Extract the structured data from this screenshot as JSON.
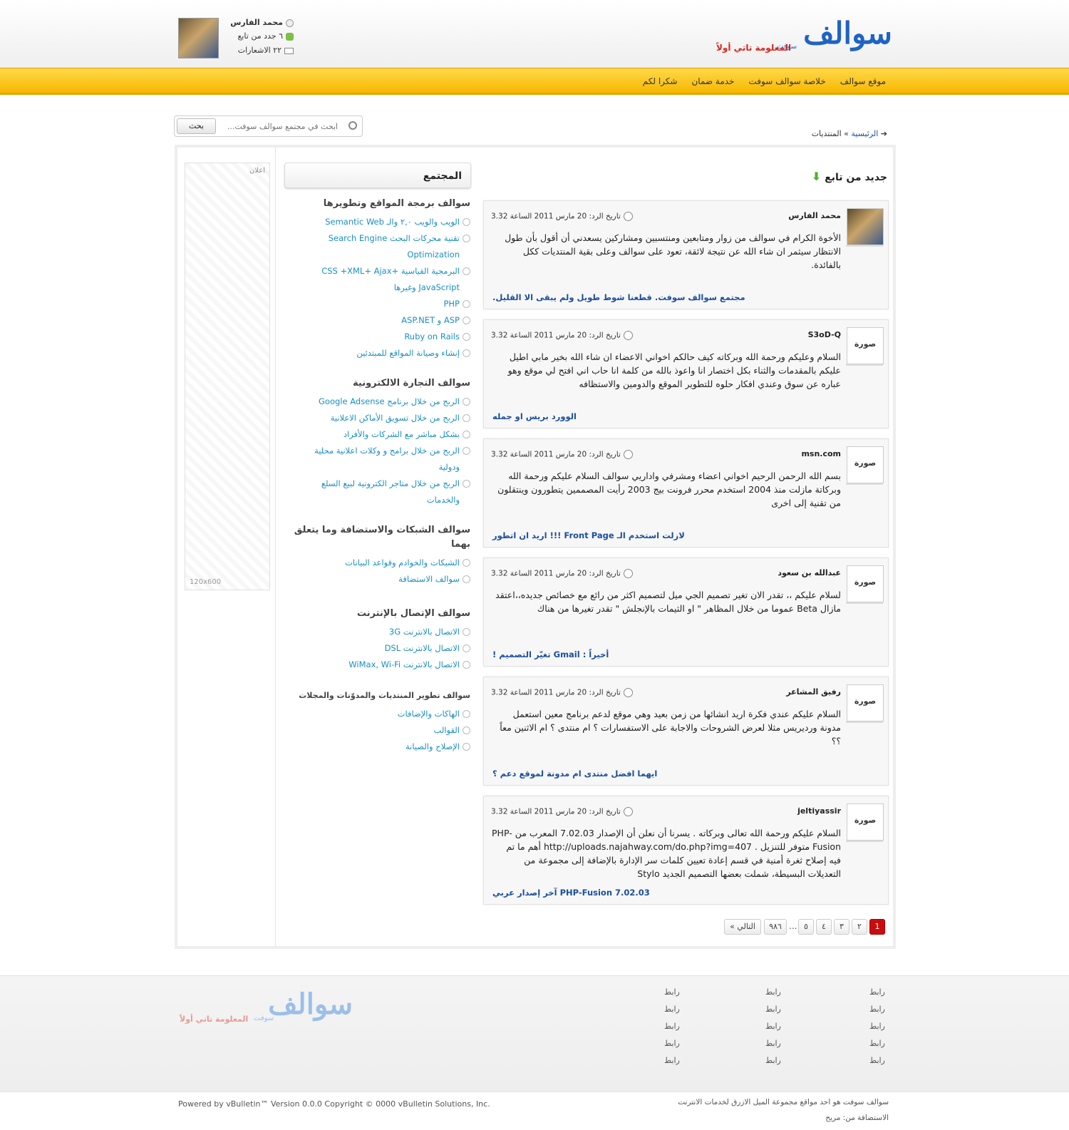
{
  "header": {
    "logo_word": "سوالف",
    "logo_sub": "سوفت",
    "logo_tagline": "المعلومة تاتي أولاً",
    "user_name": "محمد الفارس",
    "new_follow": "٦ جدد من تابع",
    "notifications": "٢٢ الاشعارات"
  },
  "nav": [
    "موقع سوالف",
    "خلاصة سوالف سوفت",
    "خدمة ضمان",
    "شكرا لكم"
  ],
  "search": {
    "placeholder": "ابحث في مجتمع سوالف سوفت...",
    "button": "بحث"
  },
  "breadcrumb": {
    "home": "الرئيسية",
    "sep": "»",
    "current": "المنتديات"
  },
  "ad": {
    "label": "اعلان",
    "size": "120x600"
  },
  "community": {
    "title": "المجتمع",
    "groups": [
      {
        "title": "سوالف برمجة المواقع وتطويرها",
        "links": [
          "الويب والويب ٢,٠ والـ Semantic Web",
          "تقنية محركات البحث Search Engine Optimization",
          "البرمجية القياسية CSS +XML+ Ajax+ JavaScript وغيرها",
          "PHP",
          "ASP و ASP.NET",
          "Ruby on Rails",
          "إنشاء وصيانة المواقع للمبتدئين"
        ]
      },
      {
        "title": "سوالف التجارة الالكترونية",
        "links": [
          "الربح من خلال برنامج Google Adsense",
          "الربح من خلال تسويق الأماكن الاعلانية",
          "بشكل مباشر مع الشركات والأفراد",
          "الربح من خلال برامج و وكلات اعلانية محلية ودولية",
          "الربح من خلال متاجر الكترونية لبيع السلع والخدمات"
        ]
      },
      {
        "title": "سوالف الشبكات والاستضافة وما يتعلق بهما",
        "links": [
          "الشبكات والخوادم وقواعد البيانات",
          "سوالف الاستضافة"
        ]
      },
      {
        "title": "سوالف الإتصال بالإنترنت",
        "links": [
          "الاتصال بالانترنت 3G",
          "الاتصال بالانترنت DSL",
          "الاتصال بالانترنت WiMax, Wi-Fi"
        ]
      },
      {
        "title": "سوالف تطوير المنتديات والمدوّنات والمجلات",
        "links": [
          "الهاكات والإضافات",
          "القوالب",
          "الإصلاح والصيانة"
        ]
      }
    ]
  },
  "feed": {
    "title": "جديد من تابع",
    "posts": [
      {
        "author": "محمد الفارس",
        "pic": "",
        "date": "تاريخ الرد: 20 مارس 2011 الساعة 3.32",
        "body": "الأخوة الكرام في سوالف من زوار ومتابعين ومنتسبين ومشاركين يسعدني أن أقول بأن طول الانتظار سيثمر ان شاء الله عن نتيجة لائقة، تعود على سوالف وعلى بقية المنتديات ككل بالفائدة.",
        "title": "مجتمع سوالف سوفت. قطعنا شوط طويل ولم يبقى الا القليل."
      },
      {
        "author": "S3oD-Q",
        "pic": "صورة",
        "date": "تاريخ الرد: 20 مارس 2011 الساعة 3.32",
        "body": "السلام وعليكم ورحمة الله وبركاته كيف حالكم اخواني الاعضاء ان شاء الله بخير مابي اطيل عليكم بالمقدمات والثناء بكل اختصار انا واعوذ بالله من كلمة انا حاب اني افتح لي موقع وهو عباره عن سوق وعندي افكار حلوه للتطوير الموقع والدومين والاستظافه",
        "title": "الوورد بريس او جمله"
      },
      {
        "author": "msn.com",
        "pic": "صورة",
        "date": "تاريخ الرد: 20 مارس 2011 الساعة 3.32",
        "body": "بسم الله الرحمن الرحيم اخواني اعضاء ومشرفي واداريي سوالف السلام عليكم ورحمة الله وبركاتة مازلت منذ 2004 استخدم محرر فرونت بيج 2003 رأيت المصممين يتطورون وينتقلون من تقنية إلى اخرى",
        "title": "لازلت استخدم الـ Front Page !!! اريد ان اتطور"
      },
      {
        "author": "عبدالله بن سعود",
        "pic": "صورة",
        "date": "تاريخ الرد: 20 مارس 2011 الساعة 3.32",
        "body": "لسلام عليكم ،، تقدر الان تغير تصميم الجي ميل لتصميم اكثر من رائع مع خصائص جديده،،اعتقد مازال Beta عموما من خلال المظاهر \" او الثيمات بالإنجلش \" تقدر تغيرها من هناك",
        "title": "أخيراً : Gmail تغيّر التصميم !"
      },
      {
        "author": "رفيق المشاعر",
        "pic": "صورة",
        "date": "تاريخ الرد: 20 مارس 2011 الساعة 3.32",
        "body": "السلام عليكم عندي فكرة اريد انشائها من زمن بعيد وهي موقع لدعم برنامج معين استعمل مدونة ورديريس مثلا لعرض الشروحات والاجابة على الاستفسارات ؟ ام منتدى ؟ ام الاثنين معاً ؟؟",
        "title": "ايهما افضل منتدى ام مدونة لموقع دعم ؟"
      },
      {
        "author": "jeltiyassir",
        "pic": "صورة",
        "date": "تاريخ الرد: 20 مارس 2011 الساعة 3.32",
        "body": "السلام عليكم ورحمة الله تعالى وبركاته . يسرنا أن نعلن أن الإصدار 7.02.03 المعرب من PHP-Fusion متوفر للتنزيل . http://uploads.najahway.com/do.php?img=407 أهم ما تم فيه إصلاح ثغرة أمنية في قسم إعادة تعيين كلمات سر الإدارة بالإضافة إلى مجموعة من التعديلات البسيطة، شملت بعضها التصميم الجديد Stylo",
        "title": "PHP-Fusion 7.02.03 آخر إصدار عربي"
      }
    ]
  },
  "pager": {
    "current": "1",
    "pages": [
      "٢",
      "٣",
      "٤",
      "٥"
    ],
    "ellipsis": "...",
    "last": "٩٨٦",
    "next": "التالي »"
  },
  "footer": {
    "link_label": "رابط",
    "logo_word": "سوالف",
    "logo_sub": "سوفت",
    "logo_tagline": "المعلومة تاتي أولاً",
    "powered": "Powered by vBulletin™ Version 0.0.0 Copyright © 0000 vBulletin Solutions, Inc.",
    "network_text": "سوالف سوفت هو احد مواقع مجموعة الميل الازرق لخدمات الانترنت",
    "hosting": "الاستضافة من: مريح"
  },
  "colors": {
    "nav_yellow": "#f6b800",
    "link_blue": "#1b4f9c",
    "community_link": "#1a8fc4",
    "pager_current": "#c90d0d",
    "logo_blue": "#1f63c4",
    "tagline_red": "#d9251c"
  }
}
